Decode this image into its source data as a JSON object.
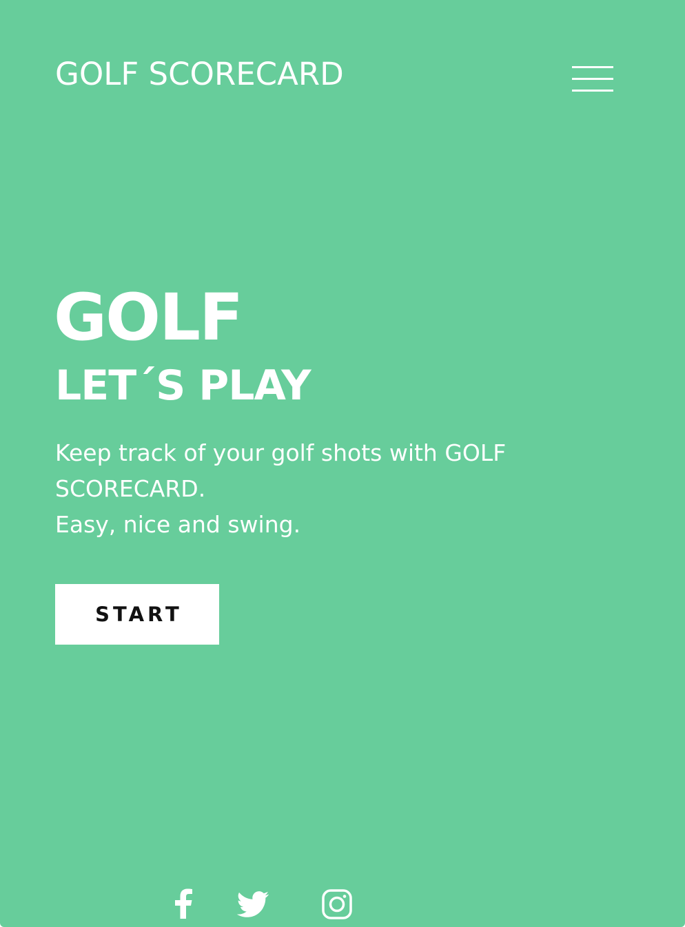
{
  "header": {
    "brand": "GOLF SCORECARD",
    "menu_icon": "hamburger-menu-icon"
  },
  "hero": {
    "title": "GOLF",
    "subtitle": "LET´S PLAY",
    "description_lines": [
      "Keep track of your golf shots with GOLF",
      "SCORECARD.",
      "Easy, nice and swing."
    ],
    "start_label": "START"
  },
  "social": {
    "icons": [
      "facebook-icon",
      "twitter-icon",
      "instagram-icon"
    ]
  },
  "colors": {
    "background": "#67cd9b",
    "text": "#ffffff",
    "button_background": "#ffffff",
    "button_text": "#111111"
  }
}
